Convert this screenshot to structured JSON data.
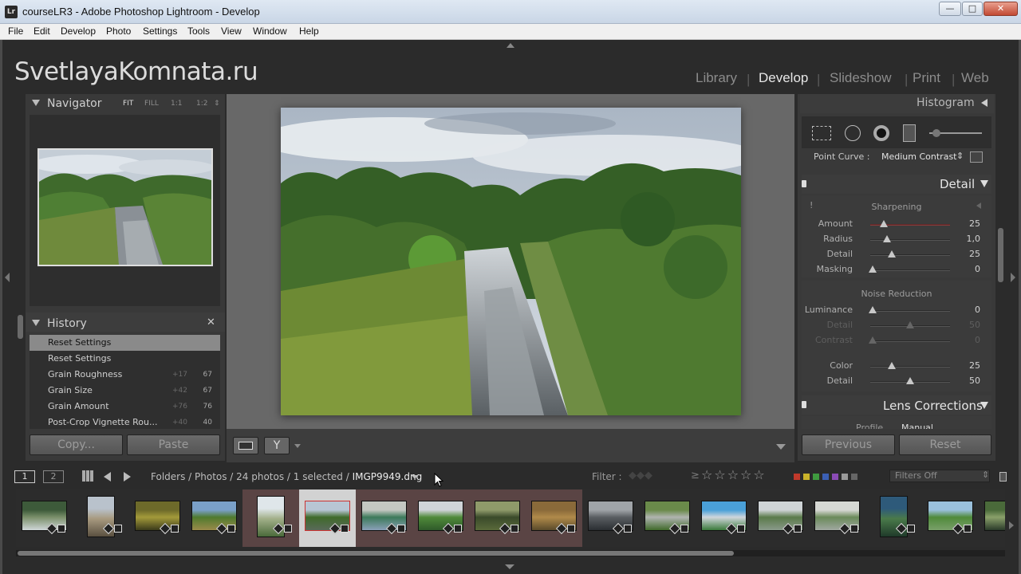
{
  "window": {
    "title": "courseLR3 - Adobe Photoshop Lightroom - Develop",
    "app_icon": "Lr",
    "min_glyph": "—",
    "max_glyph": "□",
    "close_glyph": "✕"
  },
  "menu": [
    "File",
    "Edit",
    "Develop",
    "Photo",
    "Settings",
    "Tools",
    "View",
    "Window",
    "Help"
  ],
  "identity_plate": "SvetlayaKomnata.ru",
  "modules": [
    {
      "label": "Library",
      "active": false
    },
    {
      "label": "Develop",
      "active": true
    },
    {
      "label": "Slideshow",
      "active": false
    },
    {
      "label": "Print",
      "active": false
    },
    {
      "label": "Web",
      "active": false
    }
  ],
  "module_separator": "|",
  "navigator": {
    "title": "Navigator",
    "zoom": [
      "FIT",
      "FILL",
      "1:1",
      "1:2"
    ],
    "active_zoom": "FIT",
    "zoom_arrow": "⇕"
  },
  "history": {
    "title": "History",
    "close_glyph": "✕",
    "items": [
      {
        "label": "Reset Settings",
        "delta": "",
        "value": "",
        "selected": true
      },
      {
        "label": "Reset Settings",
        "delta": "",
        "value": "",
        "selected": false
      },
      {
        "label": "Grain Roughness",
        "delta": "+17",
        "value": "67",
        "selected": false
      },
      {
        "label": "Grain Size",
        "delta": "+42",
        "value": "67",
        "selected": false
      },
      {
        "label": "Grain Amount",
        "delta": "+76",
        "value": "76",
        "selected": false
      },
      {
        "label": "Post-Crop Vignette Rou...",
        "delta": "+40",
        "value": "40",
        "selected": false
      }
    ]
  },
  "left_buttons": {
    "copy": "Copy...",
    "paste": "Paste"
  },
  "right_panel": {
    "histogram_title": "Histogram",
    "point_curve_label": "Point Curve :",
    "point_curve_value": "Medium Contrast",
    "detail_title": "Detail",
    "warning_glyph": "!",
    "sharpening_title": "Sharpening",
    "sharpening": [
      {
        "label": "Amount",
        "value": "25",
        "pos": 0.17,
        "dim": false
      },
      {
        "label": "Radius",
        "value": "1,0",
        "pos": 0.21,
        "dim": false
      },
      {
        "label": "Detail",
        "value": "25",
        "pos": 0.27,
        "dim": false
      },
      {
        "label": "Masking",
        "value": "0",
        "pos": 0.03,
        "dim": false
      }
    ],
    "noise_title": "Noise Reduction",
    "noise": [
      {
        "label": "Luminance",
        "value": "0",
        "pos": 0.03,
        "dim": false
      },
      {
        "label": "Detail",
        "value": "50",
        "pos": 0.5,
        "dim": true
      },
      {
        "label": "Contrast",
        "value": "0",
        "pos": 0.03,
        "dim": true
      }
    ],
    "color_rows": [
      {
        "label": "Color",
        "value": "25",
        "pos": 0.27,
        "dim": false
      },
      {
        "label": "Detail",
        "value": "50",
        "pos": 0.5,
        "dim": false
      }
    ],
    "lens_title": "Lens Corrections",
    "lens_peek": [
      "Profile",
      "Manual"
    ],
    "previous": "Previous",
    "reset": "Reset"
  },
  "filmstrip_bar": {
    "page1": "1",
    "page2": "2",
    "path": "Folders / Photos / 24 photos / 1 selected /",
    "filename": "IMGP9949.dng",
    "filter_label": "Filter :",
    "rating_op": "≥",
    "filters_off": "Filters Off",
    "label_colors": [
      "#c0392b",
      "#c9b32a",
      "#3f9a3f",
      "#3b5fb5",
      "#8a4bb5",
      "#9a9a9a",
      "#666666"
    ]
  },
  "filmstrip": {
    "count": 18,
    "selected_index": 5,
    "tinted": [
      4,
      5,
      6,
      7,
      8,
      9
    ],
    "thumbs": [
      {
        "colors": [
          "#3d5a3a",
          "#7a8f6a",
          "#cfd6d8"
        ],
        "portrait": false
      },
      {
        "colors": [
          "#b9c2cc",
          "#a89a80",
          "#5a5040"
        ],
        "portrait": true
      },
      {
        "colors": [
          "#6d6a2a",
          "#a39a3a",
          "#3a3a1a"
        ],
        "portrait": false
      },
      {
        "colors": [
          "#7aa0c8",
          "#4f7a2e",
          "#9a8a4a"
        ],
        "portrait": false
      },
      {
        "colors": [
          "#dfe6ea",
          "#a3b08a",
          "#4a6a3a"
        ],
        "portrait": true
      },
      {
        "colors": [
          "#b8c6d4",
          "#3f6a2a",
          "#5a6a5a"
        ],
        "portrait": false
      },
      {
        "colors": [
          "#c4c8c2",
          "#3c7a5a",
          "#8aa0b8"
        ],
        "portrait": false
      },
      {
        "colors": [
          "#d0d4d8",
          "#4f8a3a",
          "#2f5a2a"
        ],
        "portrait": false
      },
      {
        "colors": [
          "#8f9a6a",
          "#3a4a2a",
          "#5a6a3a"
        ],
        "portrait": false
      },
      {
        "colors": [
          "#8a6a3a",
          "#b08a4a",
          "#5a4a2a"
        ],
        "portrait": false
      },
      {
        "colors": [
          "#a0a4a8",
          "#5a5e62",
          "#2a2e32"
        ],
        "portrait": false
      },
      {
        "colors": [
          "#6a8a4a",
          "#b0b4b0",
          "#3f6a2a"
        ],
        "portrait": false
      },
      {
        "colors": [
          "#4aa0d8",
          "#d0d6dc",
          "#3a7a3a"
        ],
        "portrait": false
      },
      {
        "colors": [
          "#cfd4d6",
          "#5a7a4a",
          "#8a9a8a"
        ],
        "portrait": false
      },
      {
        "colors": [
          "#d6d8d4",
          "#6a8a5a",
          "#a0a8a0"
        ],
        "portrait": false
      },
      {
        "colors": [
          "#2e5a7a",
          "#4a7a4a",
          "#1f3a2a"
        ],
        "portrait": true
      },
      {
        "colors": [
          "#9ac0dc",
          "#4f8a3a",
          "#7aa06a"
        ],
        "portrait": false
      },
      {
        "colors": [
          "#4a6a3a",
          "#8aa06a",
          "#2a3a2a"
        ],
        "portrait": false
      }
    ]
  }
}
